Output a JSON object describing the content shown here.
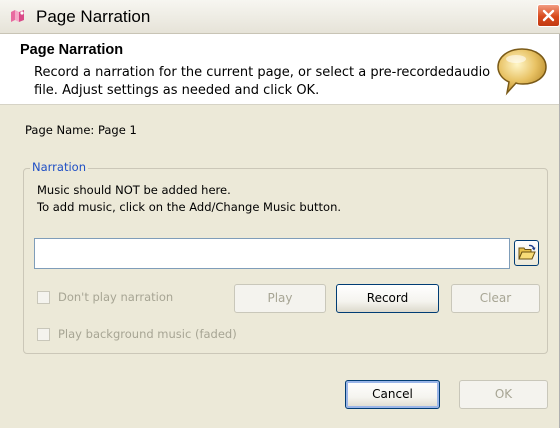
{
  "window": {
    "title": "Page Narration",
    "icon": "app-icon",
    "close_icon": "close-icon"
  },
  "header": {
    "title": "Page Narration",
    "description": "Record a narration for the current page, or select a pre-recordedaudio file. Adjust settings as needed and click OK.",
    "icon": "speech-bubble-icon"
  },
  "page_name": "Page Name: Page 1",
  "narration": {
    "legend": "Narration",
    "note_line1": "Music should NOT be added here.",
    "note_line2": "To add music, click on the Add/Change Music button.",
    "file_value": "",
    "browse_icon": "folder-open-icon",
    "dont_play_label": "Don't play narration",
    "dont_play_checked": false,
    "play_label": "Play",
    "record_label": "Record",
    "clear_label": "Clear",
    "background_music_label": "Play background music (faded)",
    "background_music_checked": false
  },
  "footer": {
    "cancel_label": "Cancel",
    "ok_label": "OK"
  },
  "colors": {
    "window_bg": "#ece9d8",
    "legend_text": "#1f4fc5",
    "disabled_text": "#a7a594",
    "button_border": "#003c74"
  }
}
